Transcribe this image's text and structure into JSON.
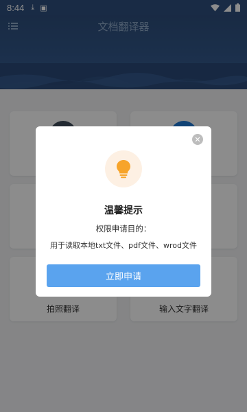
{
  "status_bar": {
    "time": "8:44"
  },
  "header": {
    "title": "文档翻译器"
  },
  "tiles": {
    "bottom_left_label": "拍照翻译",
    "bottom_right_label": "输入文字翻译"
  },
  "dialog": {
    "title": "温馨提示",
    "subtitle": "权限申请目的：",
    "description": "用于读取本地txt文件、pdf文件、wrod文件",
    "button_label": "立即申请",
    "close_glyph": "✕"
  },
  "colors": {
    "header": "#2f4f7e",
    "accent_button": "#5aa3ee",
    "bulb": "#f7a42a",
    "bulb_bg": "#fdf0e3"
  }
}
